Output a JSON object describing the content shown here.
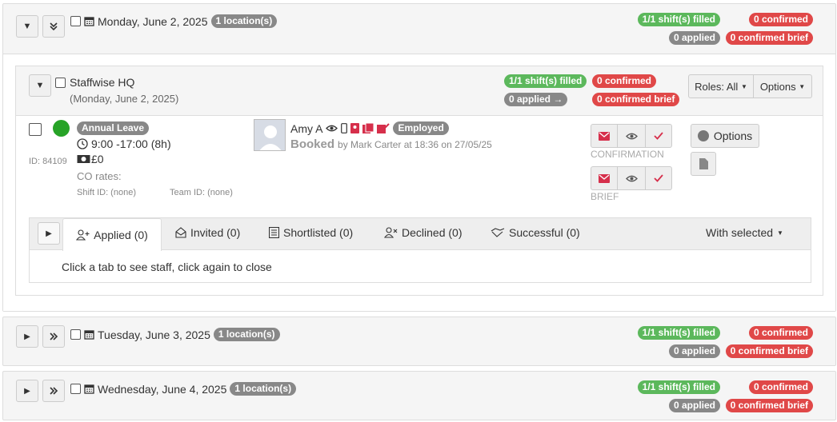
{
  "days": [
    {
      "date": "Monday, June 2, 2025",
      "locations": "1 location(s)",
      "filled": "1/1 shift(s) filled",
      "confirmed": "0 confirmed",
      "applied": "0 applied",
      "confirmed_brief": "0 confirmed brief"
    },
    {
      "date": "Tuesday, June 3, 2025",
      "locations": "1 location(s)",
      "filled": "1/1 shift(s) filled",
      "confirmed": "0 confirmed",
      "applied": "0 applied",
      "confirmed_brief": "0 confirmed brief"
    },
    {
      "date": "Wednesday, June 4, 2025",
      "locations": "1 location(s)",
      "filled": "1/1 shift(s) filled",
      "confirmed": "0 confirmed",
      "applied": "0 applied",
      "confirmed_brief": "0 confirmed brief"
    }
  ],
  "location": {
    "name": "Staffwise HQ",
    "date": "(Monday, June 2, 2025)",
    "filled": "1/1 shift(s) filled",
    "confirmed": "0 confirmed",
    "applied": "0 applied →",
    "confirmed_brief": "0 confirmed brief",
    "roles_label": "Roles: All",
    "options_label": "Options"
  },
  "shift": {
    "type": "Annual Leave",
    "time": "9:00 -17:00 (8h)",
    "pay": "£0",
    "id": "ID: 84109",
    "co_rates": "CO rates:",
    "shift_id": "Shift ID: (none)",
    "team_id": "Team ID: (none)",
    "status_color": "#27a327"
  },
  "staff": {
    "name": "Amy A",
    "employment": "Employed",
    "status": "Booked",
    "booked_by": "by Mark Carter at 18:36 on 27/05/25"
  },
  "actions": {
    "confirmation_label": "CONFIRMATION",
    "brief_label": "BRIEF",
    "options_label": "Options"
  },
  "tabs": {
    "applied": "Applied (0)",
    "invited": "Invited (0)",
    "shortlisted": "Shortlisted (0)",
    "declined": "Declined (0)",
    "successful": "Successful (0)",
    "with_selected": "With selected",
    "hint": "Click a tab to see staff, click again to close"
  }
}
